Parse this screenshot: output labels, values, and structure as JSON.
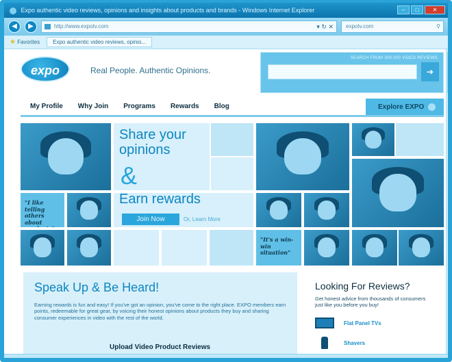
{
  "browser": {
    "title": "Expo authentic video reviews, opinions and insights about products and brands - Windows Internet Explorer",
    "url": "http://www.expotv.com",
    "search_text": "expotv.com",
    "favorites_label": "Favorites",
    "tab_label": "Expo authentic video reviews, opinio..."
  },
  "site": {
    "logo_text": "expo",
    "tagline": "Real People. Authentic Opinions.",
    "search_label": "SEARCH FROM 300,000 VIDEO REVIEWS",
    "nav": [
      "My Profile",
      "Why Join",
      "Programs",
      "Rewards",
      "Blog"
    ],
    "explore_label": "Explore EXPO"
  },
  "hero": {
    "line1": "Share your",
    "line2": "opinions",
    "amp": "&",
    "line3": "Earn rewards",
    "join_label": "Join Now",
    "learn_label": "Or, Learn More",
    "quote1": "\"I like telling others about products\"",
    "quote2": "\"It's a win-win situation\""
  },
  "speak": {
    "title": "Speak Up & Be Heard!",
    "text": "Earning rewards is fun and easy! If you've got an opinion, you've come to the right place. EXPO members earn points, redeemable for great gear, by voicing their honest opinions about products they buy and sharing consumer experiences in video with the rest of the world.",
    "upload_label": "Upload Video Product Reviews"
  },
  "reviews": {
    "title": "Looking For Reviews?",
    "text": "Get honest advice from thousands of consumers just like you before you buy!",
    "categories": [
      "Flat Panel TVs",
      "Shavers"
    ]
  }
}
